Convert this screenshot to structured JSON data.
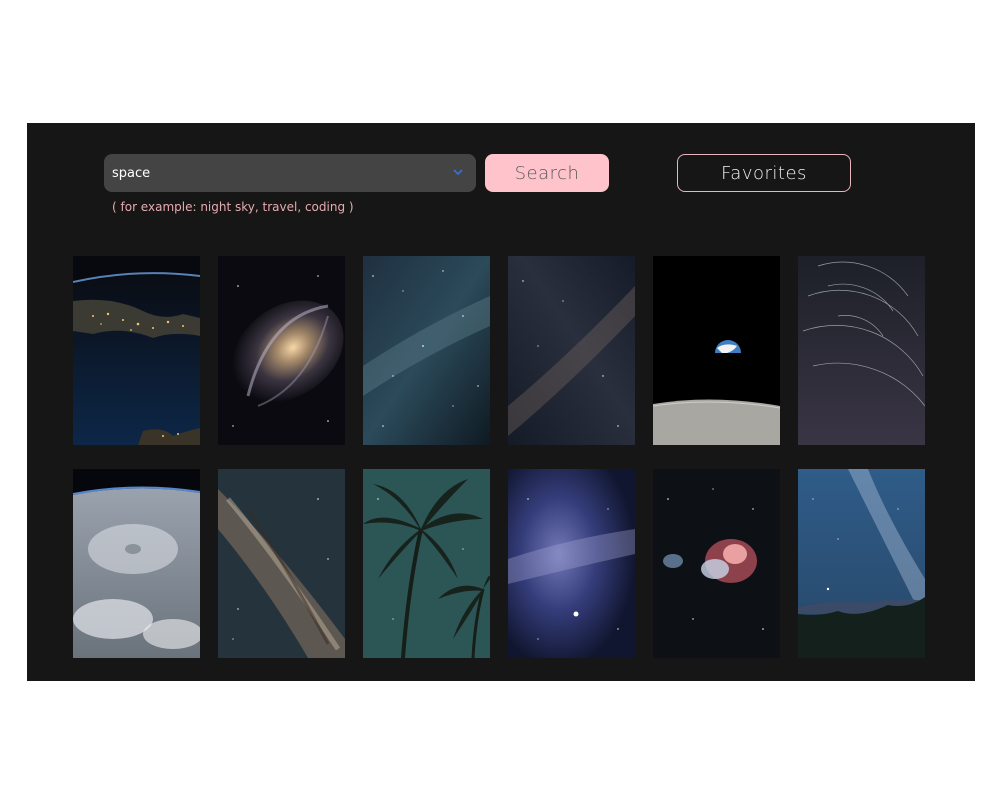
{
  "search": {
    "value": "space",
    "button_label": "Search",
    "hint": "( for example: night sky, travel, coding )"
  },
  "favorites": {
    "label": "Favorites"
  },
  "gallery": {
    "rows": [
      [
        {
          "subject": "earth-from-orbit-city-lights"
        },
        {
          "subject": "spiral-galaxy"
        },
        {
          "subject": "milky-way-starfield"
        },
        {
          "subject": "milky-way-band"
        },
        {
          "subject": "earthrise-over-moon"
        },
        {
          "subject": "star-trails"
        }
      ],
      [
        {
          "subject": "hurricane-from-orbit"
        },
        {
          "subject": "milky-way-core"
        },
        {
          "subject": "palm-trees-night-sky"
        },
        {
          "subject": "blue-starfield"
        },
        {
          "subject": "orion-nebula"
        },
        {
          "subject": "milky-way-over-forest"
        }
      ]
    ]
  },
  "colors": {
    "background": "#161616",
    "search_button": "#ffc3cb",
    "favorites_border": "#e8b7bd",
    "hint_text": "#e6aab1",
    "input_bg": "#444444"
  }
}
